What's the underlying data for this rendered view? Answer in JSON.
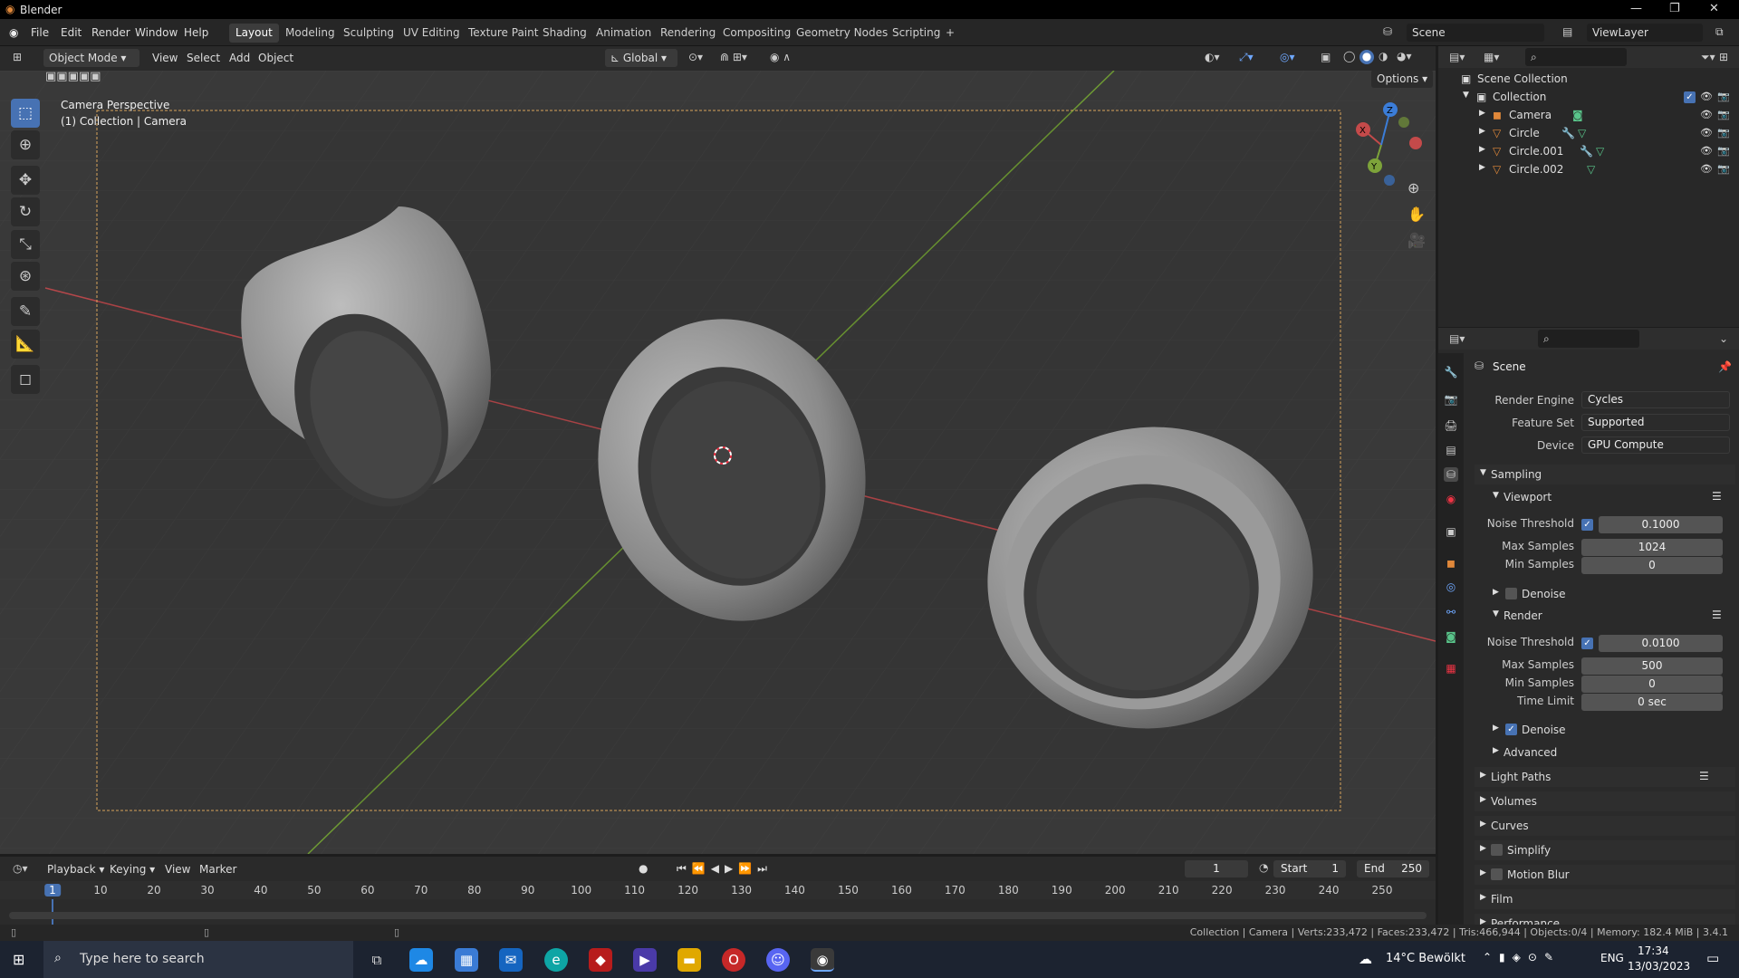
{
  "window": {
    "title": "Blender"
  },
  "menu": [
    "File",
    "Edit",
    "Render",
    "Window",
    "Help"
  ],
  "workspaces": [
    "Layout",
    "Modeling",
    "Sculpting",
    "UV Editing",
    "Texture Paint",
    "Shading",
    "Animation",
    "Rendering",
    "Compositing",
    "Geometry Nodes",
    "Scripting",
    "+"
  ],
  "active_workspace": "Layout",
  "scene_field": "Scene",
  "viewlayer_field": "ViewLayer",
  "viewport_header": {
    "mode": "Object Mode",
    "menus": [
      "View",
      "Select",
      "Add",
      "Object"
    ],
    "transform": "Global",
    "options": "Options"
  },
  "viewport": {
    "line1": "Camera Perspective",
    "line2": "(1) Collection | Camera"
  },
  "gizmo_axes": {
    "x": "X",
    "y": "Y",
    "z": "Z"
  },
  "outliner": {
    "root": "Scene Collection",
    "collection": "Collection",
    "items": [
      "Camera",
      "Circle",
      "Circle.001",
      "Circle.002"
    ]
  },
  "properties": {
    "context": "Scene",
    "render_engine_label": "Render Engine",
    "render_engine": "Cycles",
    "feature_set_label": "Feature Set",
    "feature_set": "Supported",
    "device_label": "Device",
    "device": "GPU Compute",
    "sampling": "Sampling",
    "viewport_sub": "Viewport",
    "noise_threshold_label": "Noise Threshold",
    "max_samples_label": "Max Samples",
    "min_samples_label": "Min Samples",
    "time_limit_label": "Time Limit",
    "vp_noise": "0.1000",
    "vp_max": "1024",
    "vp_min": "0",
    "denoise": "Denoise",
    "render_sub": "Render",
    "r_noise": "0.0100",
    "r_max": "500",
    "r_min": "0",
    "r_time": "0 sec",
    "advanced": "Advanced",
    "sections": [
      "Light Paths",
      "Volumes",
      "Curves",
      "Simplify",
      "Motion Blur",
      "Film",
      "Performance"
    ]
  },
  "timeline": {
    "menus": [
      "Playback",
      "Keying",
      "View",
      "Marker"
    ],
    "current_frame": "1",
    "start_label": "Start",
    "start": "1",
    "end_label": "End",
    "end": "250",
    "ticks": [
      "1",
      "10",
      "20",
      "30",
      "40",
      "50",
      "60",
      "70",
      "80",
      "90",
      "100",
      "110",
      "120",
      "130",
      "140",
      "150",
      "160",
      "170",
      "180",
      "190",
      "200",
      "210",
      "220",
      "230",
      "240",
      "250"
    ]
  },
  "status": "Collection | Camera | Verts:233,472 | Faces:233,472 | Tris:466,944 | Objects:0/4 | Memory: 182.4 MiB | 3.4.1",
  "taskbar": {
    "search_placeholder": "Type here to search",
    "weather": "14°C  Bewölkt",
    "lang": "ENG",
    "time": "17:34",
    "date": "13/03/2023"
  },
  "colors": {
    "accent": "#4772b3",
    "x_axis": "#c44a4a",
    "y_axis": "#7da33a",
    "z_axis": "#3b7dd8",
    "orange_icon": "#e0883a",
    "green_icon": "#59c48a"
  }
}
